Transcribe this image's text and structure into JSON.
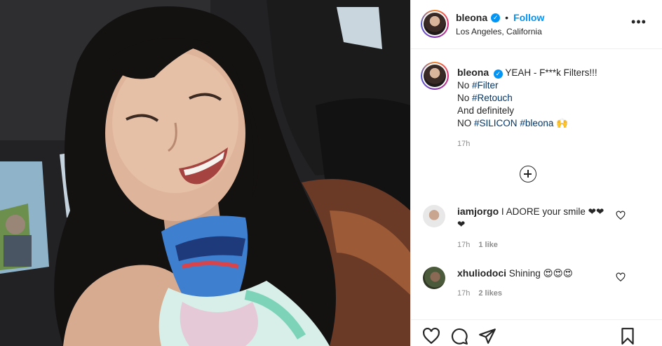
{
  "post": {
    "username": "bleona",
    "verified_mark": "✓",
    "separator": "•",
    "follow_label": "Follow",
    "location": "Los Angeles, California",
    "more_icon": "more-options-icon",
    "more_glyph": "•••"
  },
  "caption": {
    "username": "bleona",
    "line1": "YEAH - F***k Filters!!!",
    "line2_prefix": "No ",
    "line2_tag": "#Filter",
    "line3_prefix": "No ",
    "line3_tag": "#Retouch",
    "line4": "And definitely",
    "line5_prefix": "NO ",
    "line5_tag1": "#SILICON",
    "line5_tag2": "#bleona",
    "line5_suffix": " 🙌",
    "time": "17h"
  },
  "comments": [
    {
      "username": "iamjorgo",
      "text": "I ADORE your smile ❤❤ ❤",
      "time": "17h",
      "likes": "1 like"
    },
    {
      "username": "xhuliodoci",
      "text": "Shining 😍😍😍",
      "time": "17h",
      "likes": "2 likes"
    }
  ],
  "icons": {
    "load_more": "load-more-comments-icon",
    "like": "heart-icon",
    "comment": "comment-icon",
    "share": "share-icon",
    "save": "bookmark-icon"
  }
}
